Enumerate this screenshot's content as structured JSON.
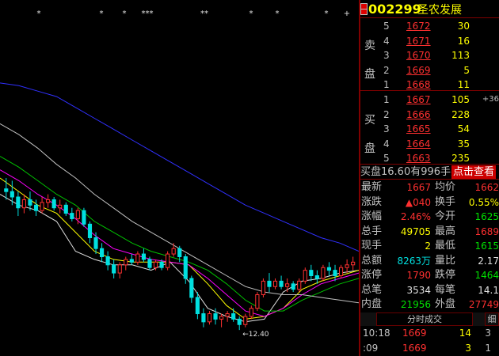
{
  "stock": {
    "code": "002299",
    "name": "圣农发展"
  },
  "order_book": {
    "sell_label": "卖盘",
    "buy_label": "买盘",
    "sell": [
      {
        "level": "5",
        "price": "1672",
        "volume": "30"
      },
      {
        "level": "4",
        "price": "1671",
        "volume": "16"
      },
      {
        "level": "3",
        "price": "1670",
        "volume": "113"
      },
      {
        "level": "2",
        "price": "1669",
        "volume": "5"
      },
      {
        "level": "1",
        "price": "1668",
        "volume": "11"
      }
    ],
    "buy": [
      {
        "level": "1",
        "price": "1667",
        "volume": "105",
        "extra": "+36"
      },
      {
        "level": "2",
        "price": "1666",
        "volume": "228",
        "extra": ""
      },
      {
        "level": "3",
        "price": "1665",
        "volume": "54",
        "extra": ""
      },
      {
        "level": "4",
        "price": "1664",
        "volume": "35",
        "extra": ""
      },
      {
        "level": "5",
        "price": "1663",
        "volume": "235",
        "extra": ""
      }
    ]
  },
  "buy_line": {
    "text": "买盘16.60有996手买",
    "button": "点击查看"
  },
  "stats": [
    {
      "l1": "最新",
      "v1": "1667",
      "c1": "red",
      "l2": "均价",
      "v2": "1662",
      "c2": "red"
    },
    {
      "l1": "涨跌",
      "v1": "▲040",
      "c1": "red",
      "l2": "换手",
      "v2": "0.55%",
      "c2": "yel"
    },
    {
      "l1": "涨幅",
      "v1": "2.46%",
      "c1": "red",
      "l2": "今开",
      "v2": "1625",
      "c2": "grn"
    },
    {
      "l1": "总手",
      "v1": "49705",
      "c1": "yel",
      "l2": "最高",
      "v2": "1689",
      "c2": "red"
    },
    {
      "l1": "现手",
      "v1": "2",
      "c1": "yel",
      "l2": "最低",
      "v2": "1615",
      "c2": "grn"
    },
    {
      "l1": "总额",
      "v1": "8263万",
      "c1": "cyan",
      "l2": "量比",
      "v2": "2.17",
      "c2": "wht"
    },
    {
      "l1": "涨停",
      "v1": "1790",
      "c1": "red",
      "l2": "跌停",
      "v2": "1464",
      "c2": "grn"
    },
    {
      "l1": "总笔",
      "v1": "3534",
      "c1": "wht",
      "l2": "每笔",
      "v2": "14.1",
      "c2": "wht"
    },
    {
      "l1": "内盘",
      "v1": "21956",
      "c1": "grn",
      "l2": "外盘",
      "v2": "27749",
      "c2": "red"
    }
  ],
  "tabs": {
    "ticks": "分时成交",
    "detail": "细"
  },
  "ticks": [
    {
      "time": "10:18",
      "price": "1669",
      "volume": "14",
      "count": "3"
    },
    {
      "time": ":09",
      "price": "1669",
      "volume": "3",
      "count": "1"
    }
  ],
  "chart_markers": [
    "*",
    "*",
    "*",
    "***",
    "**",
    "*",
    "*",
    "*",
    "+"
  ],
  "chart_label": "12.40",
  "colors": {
    "up": "#ff3030",
    "down": "#00e0e0",
    "ma5": "#e0e0e0",
    "ma10": "#ffff00",
    "ma20": "#ff00ff",
    "ma30": "#00c000",
    "ma60": "#c0c0c0",
    "ma120": "#3030ff"
  },
  "chart_data": {
    "type": "candlestick",
    "title": "",
    "xlabel": "",
    "ylabel": "",
    "ylim": [
      11.5,
      23.8
    ],
    "low_label": "12.40",
    "candles": [
      [
        17.6,
        18.0,
        17.2,
        17.5
      ],
      [
        17.5,
        17.9,
        17.0,
        17.3
      ],
      [
        17.3,
        17.5,
        16.6,
        16.9
      ],
      [
        16.9,
        17.4,
        16.7,
        17.2
      ],
      [
        17.2,
        17.5,
        16.8,
        17.0
      ],
      [
        17.0,
        17.2,
        16.6,
        16.8
      ],
      [
        16.8,
        17.3,
        16.7,
        17.1
      ],
      [
        17.1,
        17.4,
        16.9,
        17.2
      ],
      [
        17.2,
        17.3,
        16.8,
        16.9
      ],
      [
        16.9,
        17.2,
        16.7,
        17.0
      ],
      [
        17.0,
        17.1,
        16.6,
        16.7
      ],
      [
        16.7,
        16.9,
        16.4,
        16.5
      ],
      [
        16.5,
        16.9,
        16.3,
        16.8
      ],
      [
        16.8,
        16.9,
        16.2,
        16.3
      ],
      [
        16.3,
        16.4,
        15.6,
        15.8
      ],
      [
        15.8,
        16.0,
        15.2,
        15.4
      ],
      [
        15.4,
        15.6,
        14.9,
        15.1
      ],
      [
        15.1,
        15.3,
        14.6,
        14.8
      ],
      [
        14.8,
        15.0,
        14.3,
        14.5
      ],
      [
        14.5,
        14.9,
        14.3,
        14.8
      ],
      [
        14.8,
        15.1,
        14.6,
        15.0
      ],
      [
        15.0,
        15.2,
        14.8,
        14.9
      ],
      [
        14.9,
        15.3,
        14.8,
        15.2
      ],
      [
        15.2,
        15.4,
        14.9,
        15.0
      ],
      [
        15.0,
        15.1,
        14.6,
        14.7
      ],
      [
        14.7,
        15.0,
        14.6,
        14.9
      ],
      [
        14.9,
        15.0,
        14.6,
        14.7
      ],
      [
        14.7,
        15.3,
        14.6,
        15.2
      ],
      [
        15.2,
        15.6,
        15.1,
        15.4
      ],
      [
        15.4,
        15.5,
        14.9,
        15.1
      ],
      [
        15.1,
        15.2,
        14.1,
        14.3
      ],
      [
        14.3,
        14.4,
        13.4,
        13.6
      ],
      [
        13.6,
        13.8,
        12.8,
        13.0
      ],
      [
        13.0,
        13.2,
        12.5,
        12.7
      ],
      [
        12.7,
        13.1,
        12.6,
        13.0
      ],
      [
        13.0,
        13.2,
        12.6,
        12.8
      ],
      [
        12.8,
        13.0,
        12.5,
        12.9
      ],
      [
        12.9,
        13.1,
        12.7,
        13.0
      ],
      [
        13.0,
        13.2,
        12.7,
        12.8
      ],
      [
        12.8,
        12.9,
        12.4,
        12.6
      ],
      [
        12.6,
        13.0,
        12.5,
        12.9
      ],
      [
        12.9,
        13.3,
        12.8,
        13.2
      ],
      [
        13.2,
        13.8,
        13.1,
        13.7
      ],
      [
        13.7,
        14.3,
        13.6,
        14.2
      ],
      [
        14.2,
        14.5,
        13.8,
        14.0
      ],
      [
        14.0,
        14.3,
        13.9,
        14.2
      ],
      [
        14.2,
        14.4,
        13.9,
        14.0
      ],
      [
        14.0,
        14.3,
        13.8,
        14.1
      ],
      [
        14.1,
        14.2,
        13.8,
        13.9
      ],
      [
        13.9,
        14.3,
        13.8,
        14.2
      ],
      [
        14.2,
        14.7,
        14.1,
        14.6
      ],
      [
        14.6,
        14.8,
        14.2,
        14.4
      ],
      [
        14.4,
        14.6,
        14.1,
        14.3
      ],
      [
        14.3,
        14.8,
        14.2,
        14.7
      ],
      [
        14.7,
        14.9,
        14.4,
        14.6
      ],
      [
        14.6,
        14.8,
        14.2,
        14.4
      ],
      [
        14.4,
        14.8,
        14.3,
        14.7
      ],
      [
        14.7,
        15.0,
        14.5,
        14.8
      ],
      [
        14.8,
        15.1,
        14.6,
        14.9
      ]
    ],
    "ma_lines": [
      {
        "name": "MA5",
        "values": [
          17.4,
          17.0,
          16.8,
          16.4,
          15.3,
          15.0,
          14.8,
          14.8,
          14.6,
          14.9,
          14.2,
          13.2,
          12.9,
          12.7,
          12.8,
          13.8,
          14.2,
          14.3,
          14.5,
          14.6
        ]
      },
      {
        "name": "MA10",
        "values": [
          18.0,
          17.5,
          17.0,
          16.7,
          16.0,
          15.3,
          15.0,
          14.9,
          14.9,
          14.9,
          14.8,
          14.1,
          13.3,
          12.8,
          12.9,
          13.2,
          13.9,
          14.2,
          14.4,
          14.6
        ]
      },
      {
        "name": "MA20",
        "values": [
          18.3,
          17.9,
          17.4,
          17.0,
          16.5,
          15.9,
          15.4,
          15.2,
          15.0,
          14.9,
          14.8,
          14.3,
          13.7,
          13.1,
          12.9,
          13.2,
          13.7,
          14.1,
          14.3,
          14.5
        ]
      },
      {
        "name": "MA30",
        "values": [
          18.8,
          18.4,
          17.9,
          17.4,
          17.0,
          16.4,
          16.0,
          15.6,
          15.3,
          15.1,
          14.9,
          14.6,
          14.1,
          13.5,
          13.1,
          13.1,
          13.5,
          13.8,
          14.1,
          14.3
        ]
      },
      {
        "name": "MA60",
        "values": [
          20.0,
          19.6,
          19.1,
          18.5,
          18.0,
          17.4,
          16.9,
          16.4,
          16.0,
          15.6,
          15.2,
          14.8,
          14.4,
          14.0,
          13.8,
          13.7,
          13.7,
          13.6,
          13.5,
          13.4
        ]
      },
      {
        "name": "MA120",
        "values": [
          21.5,
          21.4,
          21.2,
          21.0,
          20.6,
          20.2,
          19.8,
          19.4,
          19.0,
          18.6,
          18.2,
          17.8,
          17.4,
          17.0,
          16.7,
          16.4,
          16.1,
          15.8,
          15.6,
          15.3
        ]
      }
    ]
  }
}
